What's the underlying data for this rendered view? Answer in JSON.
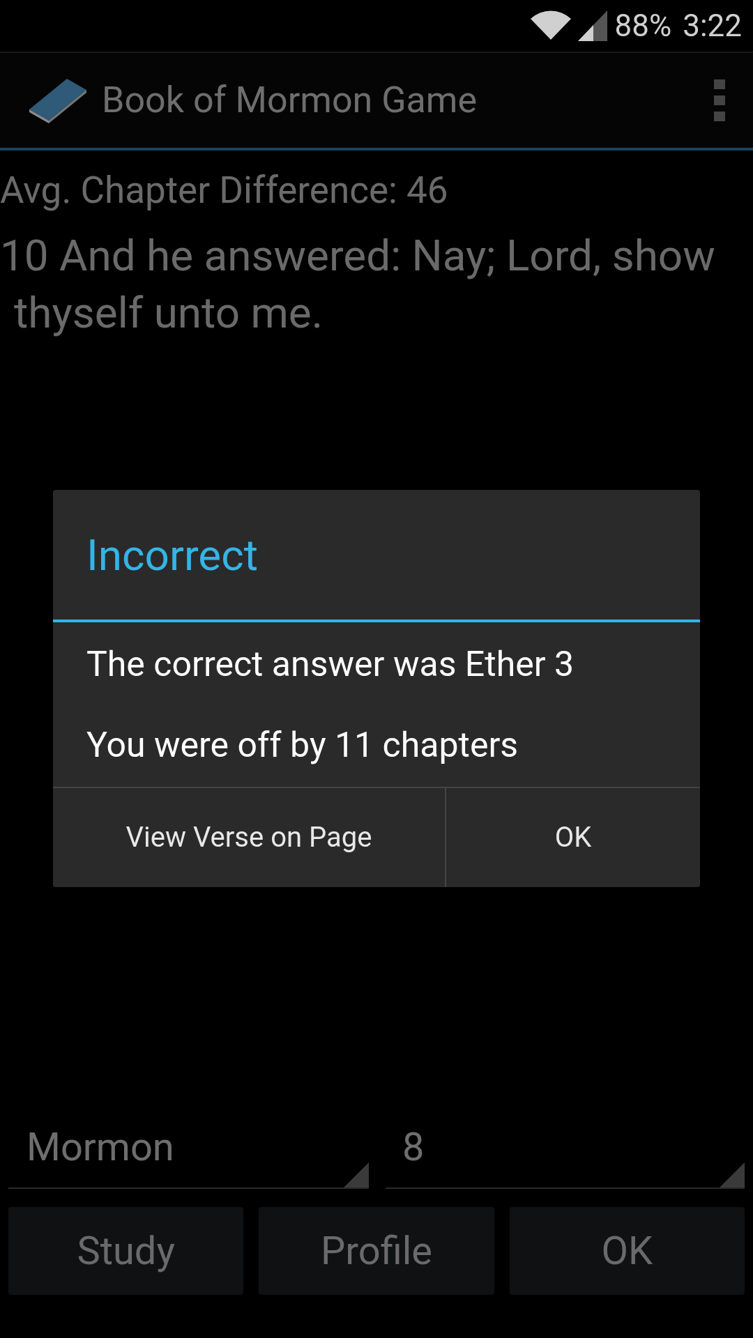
{
  "status_bar": {
    "battery": "88%",
    "time": "3:22"
  },
  "action_bar": {
    "title": "Book of Mormon Game"
  },
  "stats": {
    "avg_chapter_difference": "Avg. Chapter Difference: 46"
  },
  "verse": "10 And he answered: Nay; Lord, show thyself unto me.",
  "dialog": {
    "title": "Incorrect",
    "lines": [
      "The correct answer was Ether 3",
      "You were off by 11 chapters"
    ],
    "buttons": [
      "View Verse on Page",
      "OK"
    ]
  },
  "spinners": [
    {
      "value": "Mormon"
    },
    {
      "value": "8"
    }
  ],
  "buttons": [
    "Study",
    "Profile",
    "OK"
  ]
}
